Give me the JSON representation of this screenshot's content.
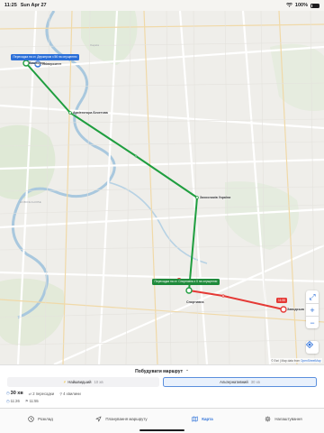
{
  "status_bar": {
    "time": "11:25",
    "date": "Sun Apr 27",
    "battery": "100%"
  },
  "map": {
    "labels": {
      "univ_stop": "Університет",
      "vyshhorod": "Вишгород",
      "architect": "Архітектора Бекетова",
      "zakhysnykiv": "Захисників України",
      "sportyvna": "Спортивна",
      "zavodska": "Заводська",
      "area_top": "Харків",
      "area_mid": "НОВОЖАНОВЕ"
    },
    "callouts": {
      "transfer_1": "Пересадка на ст. Держпром з 56 на опущенню",
      "transfer_2": "Пересадка на ст. Спортивна з 0 на опущенню"
    },
    "end_time": "11:55",
    "attribution": "© Esri | Map data from OpenStreetMap",
    "attribution_prefix": "© Esri | Map data from ",
    "attribution_link": "OpenStreetMap",
    "controls": {
      "expand": "⤢",
      "zoom_in": "+",
      "zoom_out": "−"
    },
    "colors": {
      "route_green": "#1f9e3f",
      "route_red": "#e53935",
      "route_blue": "#2b6fd8"
    }
  },
  "sheet": {
    "title": "Побудувати маршрут",
    "options": [
      {
        "label": "Найшвидший",
        "duration": "10 хв"
      },
      {
        "label": "Альтернативний",
        "duration": "30 хв"
      }
    ],
    "summary": {
      "total": "30 хв",
      "transfers": "2 пересадки",
      "walk": "4 хвилини",
      "depart": "11:26",
      "arrive": "11:55"
    }
  },
  "tabs": [
    {
      "label": "Розклад",
      "icon": "clock-icon"
    },
    {
      "label": "Планування маршруту",
      "icon": "navigation-icon"
    },
    {
      "label": "Карта",
      "icon": "map-icon"
    },
    {
      "label": "Налаштування",
      "icon": "gear-icon"
    }
  ]
}
